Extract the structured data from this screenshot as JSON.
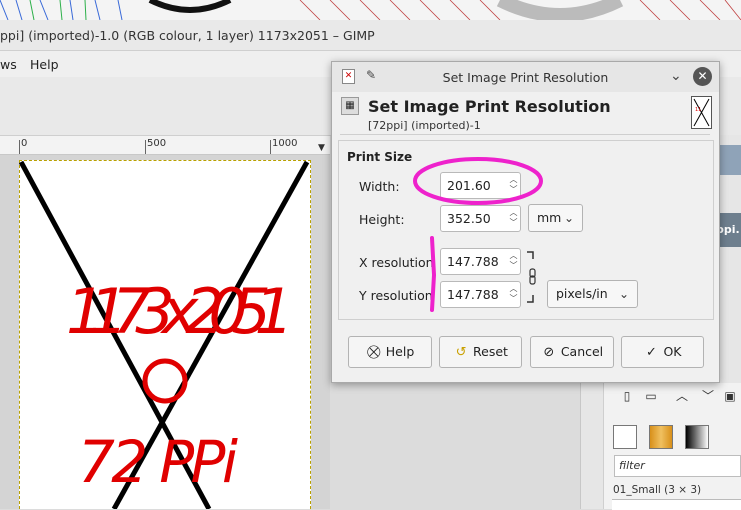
{
  "window": {
    "title": "ppi] (imported)-1.0 (RGB colour, 1 layer) 1173x2051 – GIMP"
  },
  "menu": {
    "items": [
      "ws",
      "Help"
    ]
  },
  "ruler": {
    "labels": [
      "0",
      "500",
      "1000"
    ]
  },
  "dialog": {
    "title": "Set Image Print Resolution",
    "heading": "Set Image Print Resolution",
    "subheading": "[72ppi] (imported)-1",
    "section": "Print Size",
    "width_label": "Width:",
    "width_value": "201.60",
    "height_label": "Height:",
    "height_value": "352.50",
    "size_unit": "mm",
    "xres_label": "X resolution",
    "xres_value": "147.788",
    "yres_label": "Y resolution",
    "yres_value": "147.788",
    "res_unit": "pixels/in",
    "buttons": {
      "help": "Help",
      "reset": "Reset",
      "cancel": "Cancel",
      "ok": "OK"
    }
  },
  "dock": {
    "badge": "ppi.",
    "filter_placeholder": "filter",
    "brush_name": "01_Small (3 × 3)"
  },
  "canvas_annotation": {
    "dimensions": "1173 x 2051",
    "ppi": "72 PPi"
  },
  "colors": {
    "highlight": "#ee22cc",
    "annotation": "#e00000"
  }
}
